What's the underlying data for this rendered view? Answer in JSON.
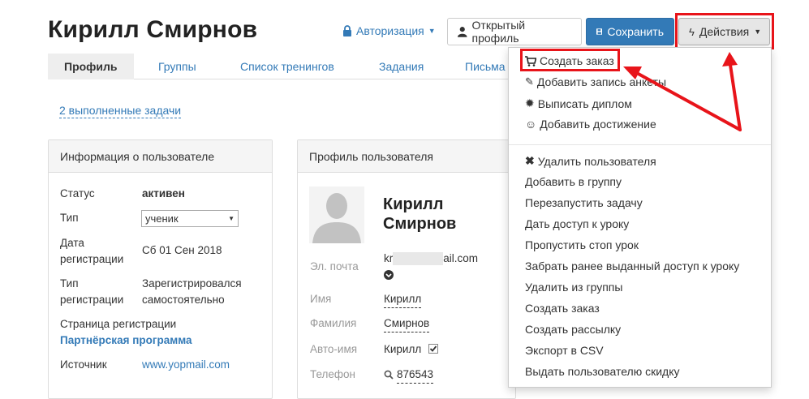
{
  "header": {
    "title": "Кирилл Смирнов",
    "auth_label": "Авторизация",
    "open_profile_label": "Открытый профиль",
    "save_label": "Сохранить",
    "actions_label": "Действия"
  },
  "tabs": [
    "Профиль",
    "Группы",
    "Список тренингов",
    "Задания",
    "Письма"
  ],
  "tasks_link": "2 выполненные задачи",
  "user_info": {
    "title": "Информация о пользователе",
    "status_label": "Статус",
    "status_value": "активен",
    "type_label": "Тип",
    "type_value": "ученик",
    "reg_date_label_1": "Дата",
    "reg_date_label_2": "регистрации",
    "reg_date_value": "Сб 01 Сен 2018",
    "reg_type_label_1": "Тип",
    "reg_type_label_2": "регистрации",
    "reg_type_value_1": "Зарегистрировался",
    "reg_type_value_2": "самостоятельно",
    "reg_page_label": "Страница регистрации",
    "reg_page_value": "Партнёрская программа",
    "source_label": "Источник",
    "source_value": "www.yopmail.com"
  },
  "profile": {
    "title": "Профиль пользователя",
    "first_name_display": "Кирилл",
    "last_name_display": "Смирнов",
    "email_label": "Эл. почта",
    "email_prefix": "kr",
    "email_suffix": "ail.com",
    "first_name_label": "Имя",
    "first_name_value": "Кирилл",
    "last_name_label": "Фамилия",
    "last_name_value": "Смирнов",
    "autoname_label": "Авто-имя",
    "autoname_value": "Кирилл",
    "phone_label": "Телефон",
    "phone_value": "876543"
  },
  "menu": {
    "items_top": [
      "Создать заказ",
      "Добавить запись анкеты",
      "Выписать диплом",
      "Добавить достижение"
    ],
    "items_bottom": [
      "Удалить пользователя",
      "Добавить в группу",
      "Перезапустить задачу",
      "Дать доступ к уроку",
      "Пропустить стоп урок",
      "Забрать ранее выданный доступ к уроку",
      "Удалить из группы",
      "Создать заказ",
      "Создать рассылку",
      "Экспорт в CSV",
      "Выдать пользователю скидку"
    ]
  },
  "colors": {
    "accent": "#337ab7",
    "annotation": "#e8141a"
  }
}
